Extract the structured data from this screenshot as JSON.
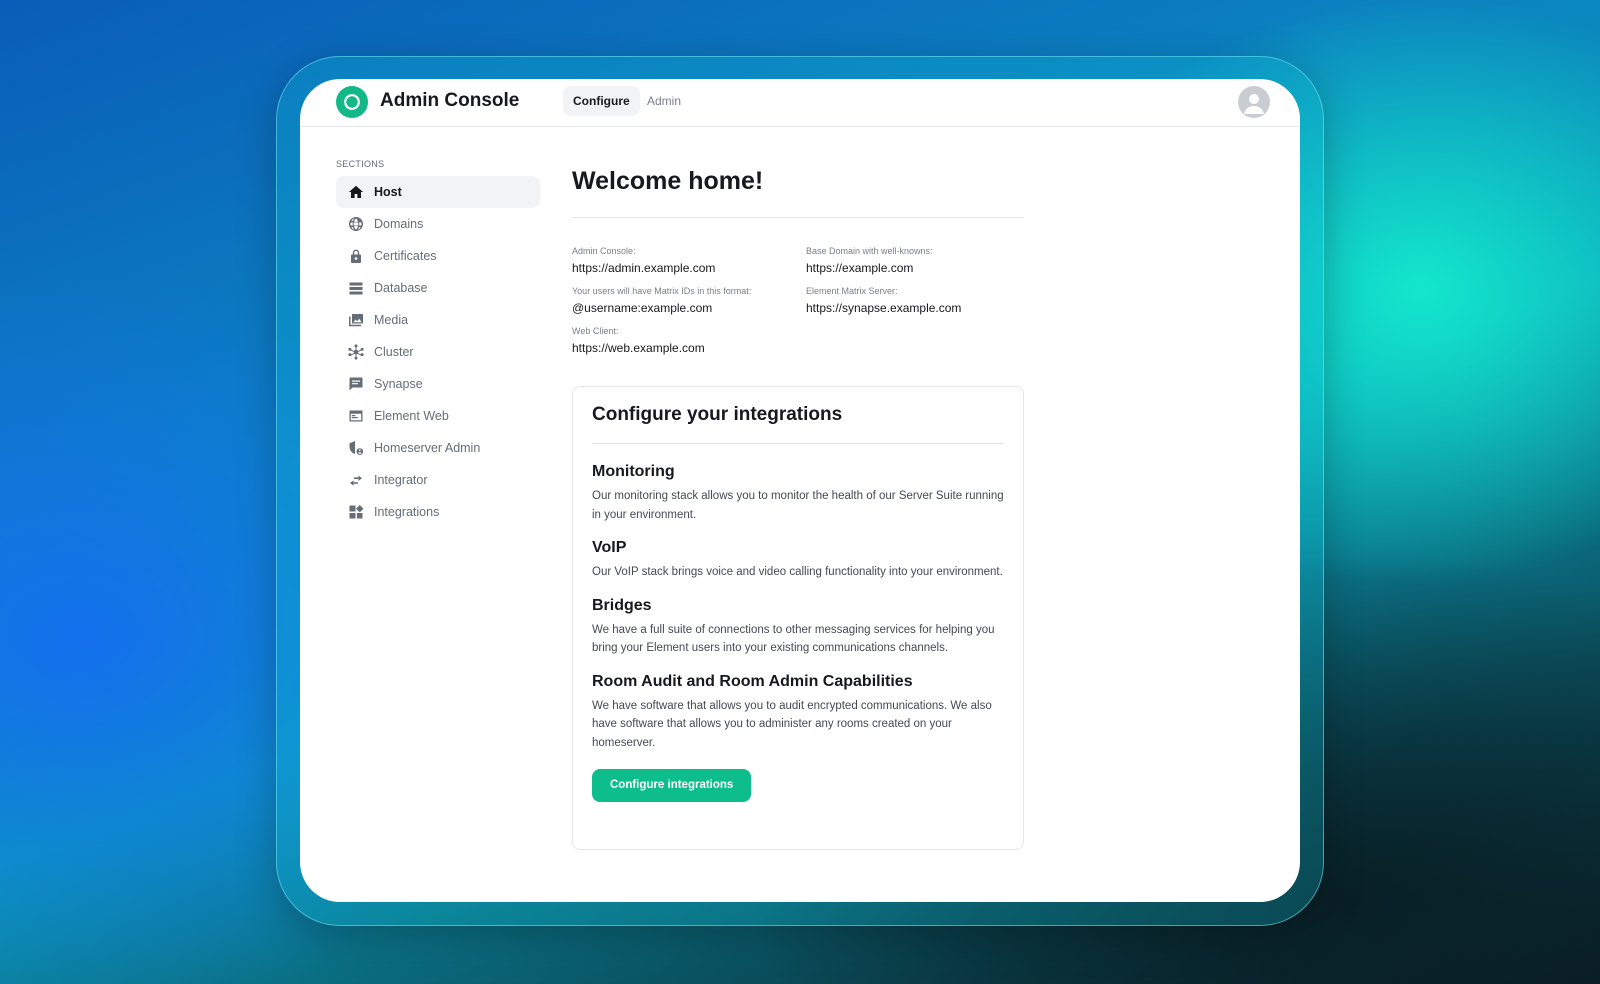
{
  "app": {
    "title": "Admin Console"
  },
  "header": {
    "tabs": [
      {
        "label": "Configure",
        "active": true
      },
      {
        "label": "Admin",
        "active": false
      }
    ]
  },
  "sidebar": {
    "section_label": "SECTIONS",
    "items": [
      {
        "label": "Host",
        "icon": "home-icon",
        "active": true
      },
      {
        "label": "Domains",
        "icon": "globe-icon",
        "active": false
      },
      {
        "label": "Certificates",
        "icon": "lock-icon",
        "active": false
      },
      {
        "label": "Database",
        "icon": "database-icon",
        "active": false
      },
      {
        "label": "Media",
        "icon": "media-icon",
        "active": false
      },
      {
        "label": "Cluster",
        "icon": "cluster-icon",
        "active": false
      },
      {
        "label": "Synapse",
        "icon": "chat-icon",
        "active": false
      },
      {
        "label": "Element Web",
        "icon": "browser-icon",
        "active": false
      },
      {
        "label": "Homeserver Admin",
        "icon": "admin-shield-icon",
        "active": false
      },
      {
        "label": "Integrator",
        "icon": "swap-icon",
        "active": false
      },
      {
        "label": "Integrations",
        "icon": "widgets-icon",
        "active": false
      }
    ]
  },
  "main": {
    "title": "Welcome home!",
    "info": {
      "admin_console_label": "Admin Console:",
      "admin_console_value": "https://admin.example.com",
      "base_domain_label": "Base Domain with well-knowns:",
      "base_domain_value": "https://example.com",
      "matrix_ids_label": "Your users will have Matrix IDs in this format:",
      "matrix_ids_value": "@username:example.com",
      "matrix_server_label": "Element Matrix Server:",
      "matrix_server_value": "https://synapse.example.com",
      "web_client_label": "Web Client:",
      "web_client_value": "https://web.example.com"
    },
    "integrations": {
      "title": "Configure your integrations",
      "features": [
        {
          "title": "Monitoring",
          "description": "Our monitoring stack allows you to monitor the health of our Server Suite running in your environment."
        },
        {
          "title": "VoIP",
          "description": "Our VoIP stack brings voice and video calling functionality into your environment."
        },
        {
          "title": "Bridges",
          "description": "We have a full suite of connections to other messaging services for helping you bring your Element users into your existing communications channels."
        },
        {
          "title": "Room Audit and Room Admin Capabilities",
          "description": "We have software that allows you to audit encrypted communications. We also have software that allows you to administer any rooms created on your homeserver."
        }
      ],
      "button_label": "Configure integrations"
    }
  },
  "colors": {
    "accent": "#0dbd8b",
    "text_primary": "#17191c",
    "text_secondary": "#656d77"
  }
}
